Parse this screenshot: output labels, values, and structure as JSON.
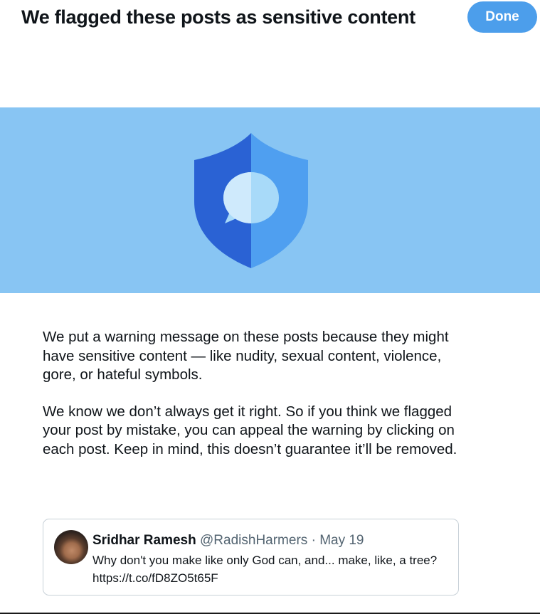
{
  "header": {
    "title": "We flagged these posts as sensitive content",
    "done_label": "Done"
  },
  "banner": {
    "background_color": "#88c5f3",
    "icon": "shield-speech-bubble-icon",
    "shield_colors": [
      "#2a62d4",
      "#4f9ff0"
    ]
  },
  "message": {
    "paragraph1": "We put a warning message on these posts because they might have sensitive content — like nudity, sexual content, violence, gore, or hateful symbols.",
    "paragraph2": "We know we don’t always get it right. So if you think we flagged your post by mistake, you can appeal the warning by clicking on each post. Keep in mind, this doesn’t guarantee it’ll be removed."
  },
  "post": {
    "author_name": "Sridhar Ramesh",
    "handle": "@RadishHarmers",
    "separator": "·",
    "date": "May 19",
    "text": "Why don't you make like only God can, and... make, like, a tree? https://t.co/fD8ZO5t65F"
  },
  "colors": {
    "accent": "#4c9eeb",
    "text_primary": "#0f1419",
    "text_secondary": "#536471",
    "card_border": "#c8d1d8"
  }
}
